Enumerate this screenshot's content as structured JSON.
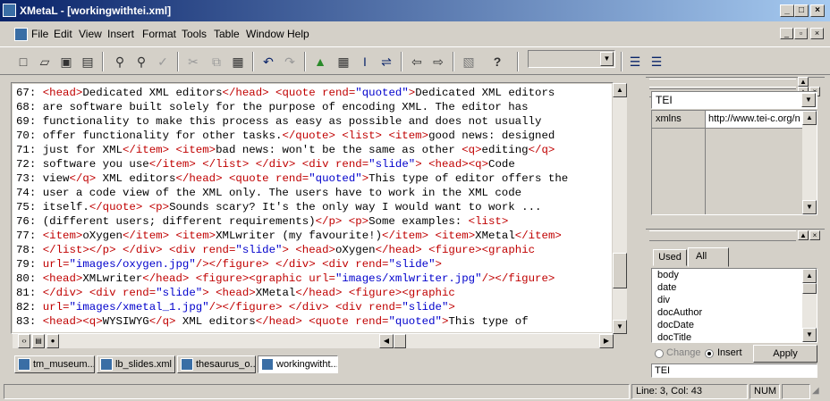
{
  "window": {
    "title": "XMetaL - [workingwithtei.xml]"
  },
  "menu": [
    "File",
    "Edit",
    "View",
    "Insert",
    "Format",
    "Tools",
    "Table",
    "Window",
    "Help"
  ],
  "toolbar": {
    "buttons": [
      "new-icon",
      "open-icon",
      "save-icon",
      "save-all-icon",
      "find-icon",
      "find-replace-icon",
      "spellcheck-icon",
      "cut-icon",
      "copy-icon",
      "paste-icon",
      "undo-icon",
      "redo-icon",
      "image-icon",
      "table-icon",
      "cursor-icon",
      "link-icon",
      "back-icon",
      "forward-icon",
      "validate-icon",
      "help-icon",
      "numbered-list-icon",
      "bullet-list-icon"
    ],
    "style_combo": ""
  },
  "editor": {
    "lines": [
      {
        "n": "67:",
        "html": "<span class=\"t\">&lt;head&gt;</span>Dedicated XML editors<span class=\"t\">&lt;/head&gt;</span> <span class=\"t\">&lt;quote</span> <span class=\"a\">rend=</span><span class=\"v\">\"quoted\"</span><span class=\"t\">&gt;</span>Dedicated XML editors"
      },
      {
        "n": "68:",
        "html": "are software built solely for the purpose of encoding XML. The editor has"
      },
      {
        "n": "69:",
        "html": "functionality to make this process as easy as possible and does not usually"
      },
      {
        "n": "70:",
        "html": "offer functionality for other tasks.<span class=\"t\">&lt;/quote&gt;</span> <span class=\"t\">&lt;list&gt;</span> <span class=\"t\">&lt;item&gt;</span>good news: designed"
      },
      {
        "n": "71:",
        "html": "just for XML<span class=\"t\">&lt;/item&gt;</span> <span class=\"t\">&lt;item&gt;</span>bad news: won't be the same as other <span class=\"t\">&lt;q&gt;</span>editing<span class=\"t\">&lt;/q&gt;</span>"
      },
      {
        "n": "72:",
        "html": "software you use<span class=\"t\">&lt;/item&gt;</span> <span class=\"t\">&lt;/list&gt;</span> <span class=\"t\">&lt;/div&gt;</span> <span class=\"t\">&lt;div</span> <span class=\"a\">rend=</span><span class=\"v\">\"slide\"</span><span class=\"t\">&gt;</span> <span class=\"t\">&lt;head&gt;&lt;q&gt;</span>Code"
      },
      {
        "n": "73:",
        "html": "view<span class=\"t\">&lt;/q&gt;</span> XML editors<span class=\"t\">&lt;/head&gt;</span> <span class=\"t\">&lt;quote</span> <span class=\"a\">rend=</span><span class=\"v\">\"quoted\"</span><span class=\"t\">&gt;</span>This type of editor offers the"
      },
      {
        "n": "74:",
        "html": "user a code view of the XML only. The users have to work in the XML code"
      },
      {
        "n": "75:",
        "html": "itself.<span class=\"t\">&lt;/quote&gt;</span> <span class=\"t\">&lt;p&gt;</span>Sounds scary? It's the only way I would want to work ..."
      },
      {
        "n": "76:",
        "html": "(different users; different requirements)<span class=\"t\">&lt;/p&gt;</span> <span class=\"t\">&lt;p&gt;</span>Some examples: <span class=\"t\">&lt;list&gt;</span>"
      },
      {
        "n": "77:",
        "html": "<span class=\"t\">&lt;item&gt;</span>oXygen<span class=\"t\">&lt;/item&gt;</span> <span class=\"t\">&lt;item&gt;</span>XMLwriter (my favourite!)<span class=\"t\">&lt;/item&gt;</span> <span class=\"t\">&lt;item&gt;</span>XMetal<span class=\"t\">&lt;/item&gt;</span>"
      },
      {
        "n": "78:",
        "html": "<span class=\"t\">&lt;/list&gt;&lt;/p&gt;</span> <span class=\"t\">&lt;/div&gt;</span> <span class=\"t\">&lt;div</span> <span class=\"a\">rend=</span><span class=\"v\">\"slide\"</span><span class=\"t\">&gt;</span> <span class=\"t\">&lt;head&gt;</span>oXygen<span class=\"t\">&lt;/head&gt;</span> <span class=\"t\">&lt;figure&gt;&lt;graphic</span>"
      },
      {
        "n": "79:",
        "html": "<span class=\"a\">url=</span><span class=\"v\">\"images/oxygen.jpg\"</span><span class=\"t\">/&gt;&lt;/figure&gt;</span> <span class=\"t\">&lt;/div&gt;</span> <span class=\"t\">&lt;div</span> <span class=\"a\">rend=</span><span class=\"v\">\"slide\"</span><span class=\"t\">&gt;</span>"
      },
      {
        "n": "80:",
        "html": "<span class=\"t\">&lt;head&gt;</span>XMLwriter<span class=\"t\">&lt;/head&gt;</span> <span class=\"t\">&lt;figure&gt;&lt;graphic</span> <span class=\"a\">url=</span><span class=\"v\">\"images/xmlwriter.jpg\"</span><span class=\"t\">/&gt;&lt;/figure&gt;</span>"
      },
      {
        "n": "81:",
        "html": "<span class=\"t\">&lt;/div&gt;</span> <span class=\"t\">&lt;div</span> <span class=\"a\">rend=</span><span class=\"v\">\"slide\"</span><span class=\"t\">&gt;</span> <span class=\"t\">&lt;head&gt;</span>XMetal<span class=\"t\">&lt;/head&gt;</span> <span class=\"t\">&lt;figure&gt;&lt;graphic</span>"
      },
      {
        "n": "82:",
        "html": "<span class=\"a\">url=</span><span class=\"v\">\"images/xmetal_1.jpg\"</span><span class=\"t\">/&gt;&lt;/figure&gt;</span> <span class=\"t\">&lt;/div&gt;</span> <span class=\"t\">&lt;div</span> <span class=\"a\">rend=</span><span class=\"v\">\"slide\"</span><span class=\"t\">&gt;</span>"
      },
      {
        "n": "83:",
        "html": "<span class=\"t\">&lt;head&gt;&lt;q&gt;</span>WYSIWYG<span class=\"t\">&lt;/q&gt;</span> XML editors<span class=\"t\">&lt;/head&gt;</span> <span class=\"t\">&lt;quote</span> <span class=\"a\">rend=</span><span class=\"v\">\"quoted\"</span><span class=\"t\">&gt;</span>This type of"
      }
    ]
  },
  "doc_tabs": [
    {
      "label": "tm_museum...",
      "active": false
    },
    {
      "label": "lb_slides.xml",
      "active": false
    },
    {
      "label": "thesaurus_o...",
      "active": false
    },
    {
      "label": "workingwitht...",
      "active": true
    }
  ],
  "attributes_panel": {
    "element": "TEI",
    "rows": [
      {
        "name": "xmlns",
        "value": "http://www.tei-c.org/n"
      }
    ]
  },
  "elements_panel": {
    "tabs": [
      "Used",
      "All"
    ],
    "active_tab": "All",
    "items": [
      "body",
      "date",
      "div",
      "docAuthor",
      "docDate",
      "docTitle"
    ],
    "mode_change": "Change",
    "mode_insert": "Insert",
    "selected_mode": "Insert",
    "apply": "Apply",
    "current": "TEI"
  },
  "status": {
    "position": "Line: 3, Col: 43",
    "num": "NUM"
  },
  "colors": {
    "tag": "#c00000",
    "value": "#0000cc",
    "title_start": "#0a246a",
    "title_end": "#a6caf0"
  }
}
